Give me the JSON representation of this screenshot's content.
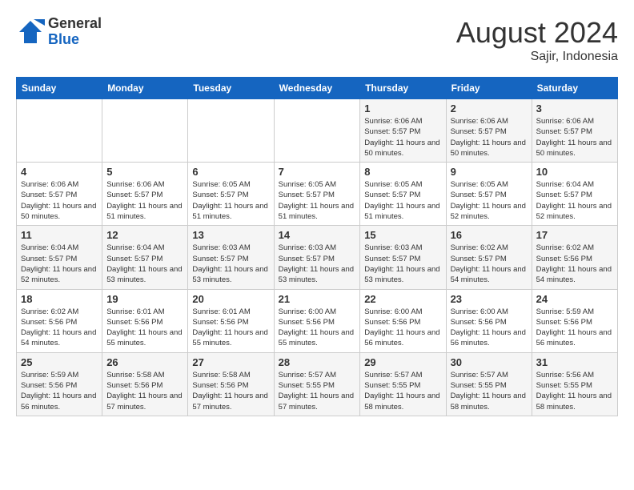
{
  "logo": {
    "general": "General",
    "blue": "Blue"
  },
  "title": {
    "month_year": "August 2024",
    "location": "Sajir, Indonesia"
  },
  "headers": [
    "Sunday",
    "Monday",
    "Tuesday",
    "Wednesday",
    "Thursday",
    "Friday",
    "Saturday"
  ],
  "weeks": [
    [
      {
        "day": "",
        "sunrise": "",
        "sunset": "",
        "daylight": ""
      },
      {
        "day": "",
        "sunrise": "",
        "sunset": "",
        "daylight": ""
      },
      {
        "day": "",
        "sunrise": "",
        "sunset": "",
        "daylight": ""
      },
      {
        "day": "",
        "sunrise": "",
        "sunset": "",
        "daylight": ""
      },
      {
        "day": "1",
        "sunrise": "Sunrise: 6:06 AM",
        "sunset": "Sunset: 5:57 PM",
        "daylight": "Daylight: 11 hours and 50 minutes."
      },
      {
        "day": "2",
        "sunrise": "Sunrise: 6:06 AM",
        "sunset": "Sunset: 5:57 PM",
        "daylight": "Daylight: 11 hours and 50 minutes."
      },
      {
        "day": "3",
        "sunrise": "Sunrise: 6:06 AM",
        "sunset": "Sunset: 5:57 PM",
        "daylight": "Daylight: 11 hours and 50 minutes."
      }
    ],
    [
      {
        "day": "4",
        "sunrise": "Sunrise: 6:06 AM",
        "sunset": "Sunset: 5:57 PM",
        "daylight": "Daylight: 11 hours and 50 minutes."
      },
      {
        "day": "5",
        "sunrise": "Sunrise: 6:06 AM",
        "sunset": "Sunset: 5:57 PM",
        "daylight": "Daylight: 11 hours and 51 minutes."
      },
      {
        "day": "6",
        "sunrise": "Sunrise: 6:05 AM",
        "sunset": "Sunset: 5:57 PM",
        "daylight": "Daylight: 11 hours and 51 minutes."
      },
      {
        "day": "7",
        "sunrise": "Sunrise: 6:05 AM",
        "sunset": "Sunset: 5:57 PM",
        "daylight": "Daylight: 11 hours and 51 minutes."
      },
      {
        "day": "8",
        "sunrise": "Sunrise: 6:05 AM",
        "sunset": "Sunset: 5:57 PM",
        "daylight": "Daylight: 11 hours and 51 minutes."
      },
      {
        "day": "9",
        "sunrise": "Sunrise: 6:05 AM",
        "sunset": "Sunset: 5:57 PM",
        "daylight": "Daylight: 11 hours and 52 minutes."
      },
      {
        "day": "10",
        "sunrise": "Sunrise: 6:04 AM",
        "sunset": "Sunset: 5:57 PM",
        "daylight": "Daylight: 11 hours and 52 minutes."
      }
    ],
    [
      {
        "day": "11",
        "sunrise": "Sunrise: 6:04 AM",
        "sunset": "Sunset: 5:57 PM",
        "daylight": "Daylight: 11 hours and 52 minutes."
      },
      {
        "day": "12",
        "sunrise": "Sunrise: 6:04 AM",
        "sunset": "Sunset: 5:57 PM",
        "daylight": "Daylight: 11 hours and 53 minutes."
      },
      {
        "day": "13",
        "sunrise": "Sunrise: 6:03 AM",
        "sunset": "Sunset: 5:57 PM",
        "daylight": "Daylight: 11 hours and 53 minutes."
      },
      {
        "day": "14",
        "sunrise": "Sunrise: 6:03 AM",
        "sunset": "Sunset: 5:57 PM",
        "daylight": "Daylight: 11 hours and 53 minutes."
      },
      {
        "day": "15",
        "sunrise": "Sunrise: 6:03 AM",
        "sunset": "Sunset: 5:57 PM",
        "daylight": "Daylight: 11 hours and 53 minutes."
      },
      {
        "day": "16",
        "sunrise": "Sunrise: 6:02 AM",
        "sunset": "Sunset: 5:57 PM",
        "daylight": "Daylight: 11 hours and 54 minutes."
      },
      {
        "day": "17",
        "sunrise": "Sunrise: 6:02 AM",
        "sunset": "Sunset: 5:56 PM",
        "daylight": "Daylight: 11 hours and 54 minutes."
      }
    ],
    [
      {
        "day": "18",
        "sunrise": "Sunrise: 6:02 AM",
        "sunset": "Sunset: 5:56 PM",
        "daylight": "Daylight: 11 hours and 54 minutes."
      },
      {
        "day": "19",
        "sunrise": "Sunrise: 6:01 AM",
        "sunset": "Sunset: 5:56 PM",
        "daylight": "Daylight: 11 hours and 55 minutes."
      },
      {
        "day": "20",
        "sunrise": "Sunrise: 6:01 AM",
        "sunset": "Sunset: 5:56 PM",
        "daylight": "Daylight: 11 hours and 55 minutes."
      },
      {
        "day": "21",
        "sunrise": "Sunrise: 6:00 AM",
        "sunset": "Sunset: 5:56 PM",
        "daylight": "Daylight: 11 hours and 55 minutes."
      },
      {
        "day": "22",
        "sunrise": "Sunrise: 6:00 AM",
        "sunset": "Sunset: 5:56 PM",
        "daylight": "Daylight: 11 hours and 56 minutes."
      },
      {
        "day": "23",
        "sunrise": "Sunrise: 6:00 AM",
        "sunset": "Sunset: 5:56 PM",
        "daylight": "Daylight: 11 hours and 56 minutes."
      },
      {
        "day": "24",
        "sunrise": "Sunrise: 5:59 AM",
        "sunset": "Sunset: 5:56 PM",
        "daylight": "Daylight: 11 hours and 56 minutes."
      }
    ],
    [
      {
        "day": "25",
        "sunrise": "Sunrise: 5:59 AM",
        "sunset": "Sunset: 5:56 PM",
        "daylight": "Daylight: 11 hours and 56 minutes."
      },
      {
        "day": "26",
        "sunrise": "Sunrise: 5:58 AM",
        "sunset": "Sunset: 5:56 PM",
        "daylight": "Daylight: 11 hours and 57 minutes."
      },
      {
        "day": "27",
        "sunrise": "Sunrise: 5:58 AM",
        "sunset": "Sunset: 5:56 PM",
        "daylight": "Daylight: 11 hours and 57 minutes."
      },
      {
        "day": "28",
        "sunrise": "Sunrise: 5:57 AM",
        "sunset": "Sunset: 5:55 PM",
        "daylight": "Daylight: 11 hours and 57 minutes."
      },
      {
        "day": "29",
        "sunrise": "Sunrise: 5:57 AM",
        "sunset": "Sunset: 5:55 PM",
        "daylight": "Daylight: 11 hours and 58 minutes."
      },
      {
        "day": "30",
        "sunrise": "Sunrise: 5:57 AM",
        "sunset": "Sunset: 5:55 PM",
        "daylight": "Daylight: 11 hours and 58 minutes."
      },
      {
        "day": "31",
        "sunrise": "Sunrise: 5:56 AM",
        "sunset": "Sunset: 5:55 PM",
        "daylight": "Daylight: 11 hours and 58 minutes."
      }
    ]
  ]
}
